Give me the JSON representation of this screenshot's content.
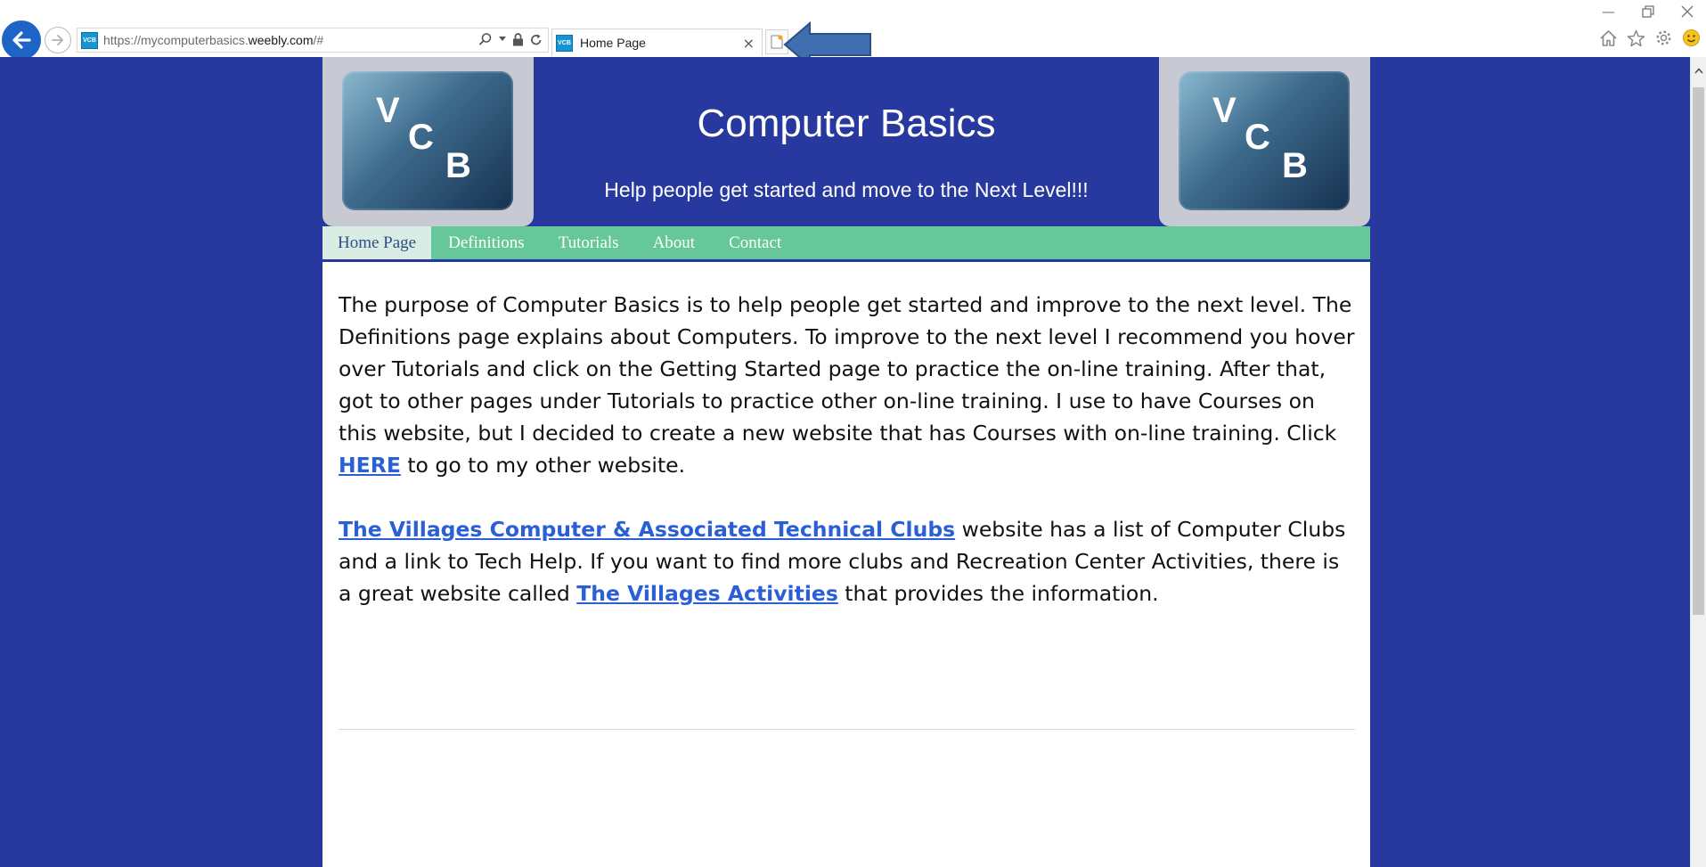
{
  "browser": {
    "url_prefix": "https://mycomputerbasics.",
    "url_domain": "weebly.com",
    "url_suffix": "/#",
    "favicon_text": "VCB",
    "tab_title": "Home Page",
    "tab_close": "×"
  },
  "site": {
    "logo_letters": [
      "V",
      "C",
      "B"
    ],
    "title": "Computer Basics",
    "tagline": "Help people get started and move to the Next Level!!!",
    "nav": [
      "Home Page",
      "Definitions",
      "Tutorials",
      "About",
      "Contact"
    ],
    "active_nav": "Home Page"
  },
  "content": {
    "p1_text": "The purpose of Computer Basics is to help people get started and improve to the next level.  The Definitions page explains about Computers.  To improve to the next level I recommend you hover over Tutorials and click on the Getting Started page to practice the on-line training.  After that, got to other pages under Tutorials to practice other on-line training.  I use to have Courses on this website, but I decided to create a new website that has Courses with on-line training.  Click ",
    "p1_link": "HERE",
    "p1_tail": " to go to my other website.",
    "p2_link1": "The Villages Computer & Associated Technical Clubs",
    "p2_text1": " website has a list of Computer Clubs and a link to Tech Help.  If you want to find more clubs and Recreation Center Activities, there is a great website called ",
    "p2_link2": "The Villages Activities",
    "p2_text2": " that provides the information."
  },
  "colors": {
    "page_background": "#27399f",
    "nav_background": "#66c79a",
    "link": "#2a5fd6",
    "browser_back_button": "#1d64c6",
    "annotation_arrow": "#3f6fb0"
  }
}
